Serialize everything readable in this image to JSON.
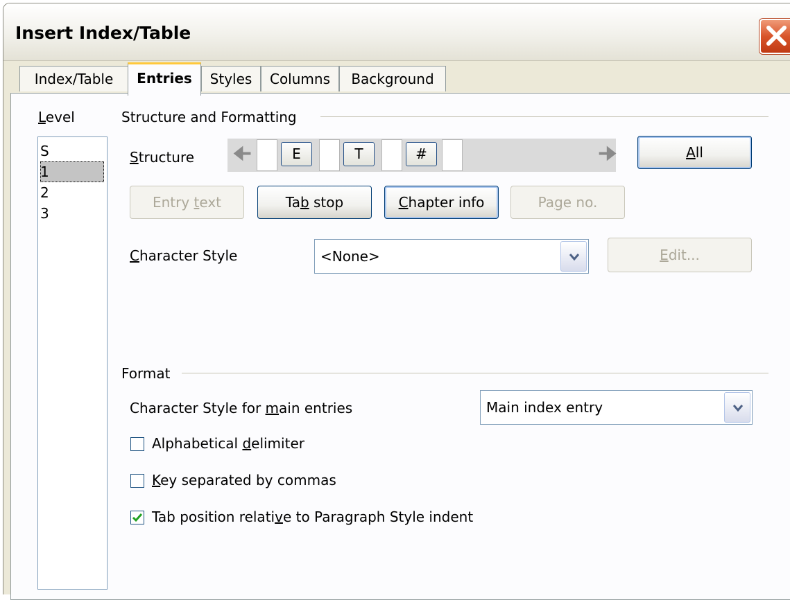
{
  "dialog": {
    "title": "Insert Index/Table"
  },
  "tabs": [
    {
      "label": "Index/Table"
    },
    {
      "label": "Entries",
      "active": true
    },
    {
      "label": "Styles"
    },
    {
      "label": "Columns"
    },
    {
      "label": "Background"
    }
  ],
  "level": {
    "label": "Level",
    "items": [
      "S",
      "1",
      "2",
      "3"
    ],
    "selected": "1"
  },
  "structure_formatting": {
    "heading": "Structure and Formatting",
    "structure_label": "Structure",
    "tokens": [
      "E",
      "T",
      "#"
    ],
    "all_button": "All",
    "buttons": {
      "entry_text": "Entry text",
      "tab_stop": "Tab stop",
      "chapter_info": "Chapter info",
      "page_no": "Page no."
    },
    "char_style_label": "Character Style",
    "char_style_value": "<None>",
    "edit_button": "Edit..."
  },
  "format": {
    "heading": "Format",
    "main_entries_label": "Character Style for main entries",
    "main_entries_value": "Main index entry",
    "checkboxes": [
      {
        "label": "Alphabetical delimiter",
        "checked": false
      },
      {
        "label": "Key separated by commas",
        "checked": false
      },
      {
        "label": "Tab position relative to Paragraph Style indent",
        "checked": true
      }
    ]
  },
  "colors": {
    "accent_tab": "#ffc83c",
    "check": "#21a121",
    "close": "#d8542a"
  }
}
